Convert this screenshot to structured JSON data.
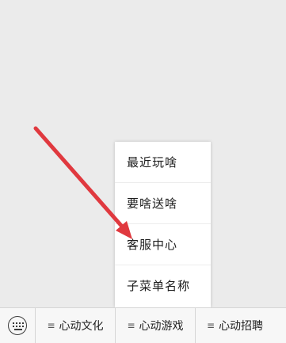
{
  "submenu": {
    "items": [
      {
        "label": "最近玩啥"
      },
      {
        "label": "要啥送啥"
      },
      {
        "label": "客服中心"
      },
      {
        "label": "子菜单名称"
      }
    ]
  },
  "menu_bar": {
    "keyboard_icon": "keyboard-icon",
    "tabs": [
      {
        "icon": "≡",
        "label": "心动文化"
      },
      {
        "icon": "≡",
        "label": "心动游戏"
      },
      {
        "icon": "≡",
        "label": "心动招聘"
      }
    ]
  },
  "annotation": {
    "arrow_color": "#e0393f"
  }
}
